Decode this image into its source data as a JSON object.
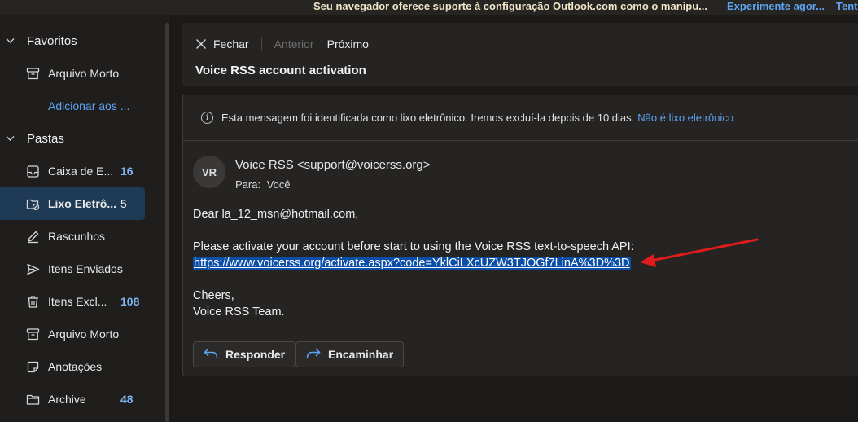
{
  "banner": {
    "message": "Seu navegador oferece suporte à configuração Outlook.com como o manipu...",
    "try_link": "Experimente agor...",
    "more_link": "Tent"
  },
  "sidebar": {
    "favorites": {
      "title": "Favoritos",
      "items": [
        {
          "label": "Arquivo Morto",
          "count": "",
          "icon": "archive-icon"
        }
      ],
      "add_link": "Adicionar aos ..."
    },
    "folders": {
      "title": "Pastas",
      "items": [
        {
          "label": "Caixa de E...",
          "count": "16",
          "icon": "inbox-icon"
        },
        {
          "label": "Lixo Eletrô...",
          "count": "5",
          "icon": "junk-folder-icon",
          "selected": true
        },
        {
          "label": "Rascunhos",
          "count": "",
          "icon": "pencil-icon"
        },
        {
          "label": "Itens Enviados",
          "count": "",
          "icon": "send-icon"
        },
        {
          "label": "Itens Excl...",
          "count": "108",
          "icon": "trash-icon"
        },
        {
          "label": "Arquivo Morto",
          "count": "",
          "icon": "archive-icon"
        },
        {
          "label": "Anotações",
          "count": "",
          "icon": "note-icon"
        },
        {
          "label": "Archive",
          "count": "48",
          "icon": "folder-icon"
        }
      ]
    }
  },
  "toolbar": {
    "close_label": "Fechar",
    "prev_label": "Anterior",
    "next_label": "Próximo",
    "subject": "Voice RSS account activation"
  },
  "message": {
    "junk_notice": "Esta mensagem foi identificada como lixo eletrônico. Iremos excluí-la depois de 10 dias.",
    "not_junk_link": "Não é lixo eletrônico",
    "avatar_initials": "VR",
    "sender": "Voice RSS <support@voicerss.org>",
    "to_prefix": "Para:",
    "to": "Você",
    "body": {
      "greeting": "Dear la_12_msn@hotmail.com,",
      "line1": "Please activate your account before start to using the Voice RSS text-to-speech API:",
      "link": "https://www.voicerss.org/activate.aspx?code=YklCiLXcUZW3TJOGf7LinA%3D%3D",
      "closing": "Cheers,",
      "signature": "Voice RSS Team."
    },
    "reply_label": "Responder",
    "forward_label": "Encaminhar"
  },
  "colors": {
    "accent": "#5ea4f5",
    "selection": "#0b4ea8",
    "annotation_arrow": "#e01b1b"
  }
}
